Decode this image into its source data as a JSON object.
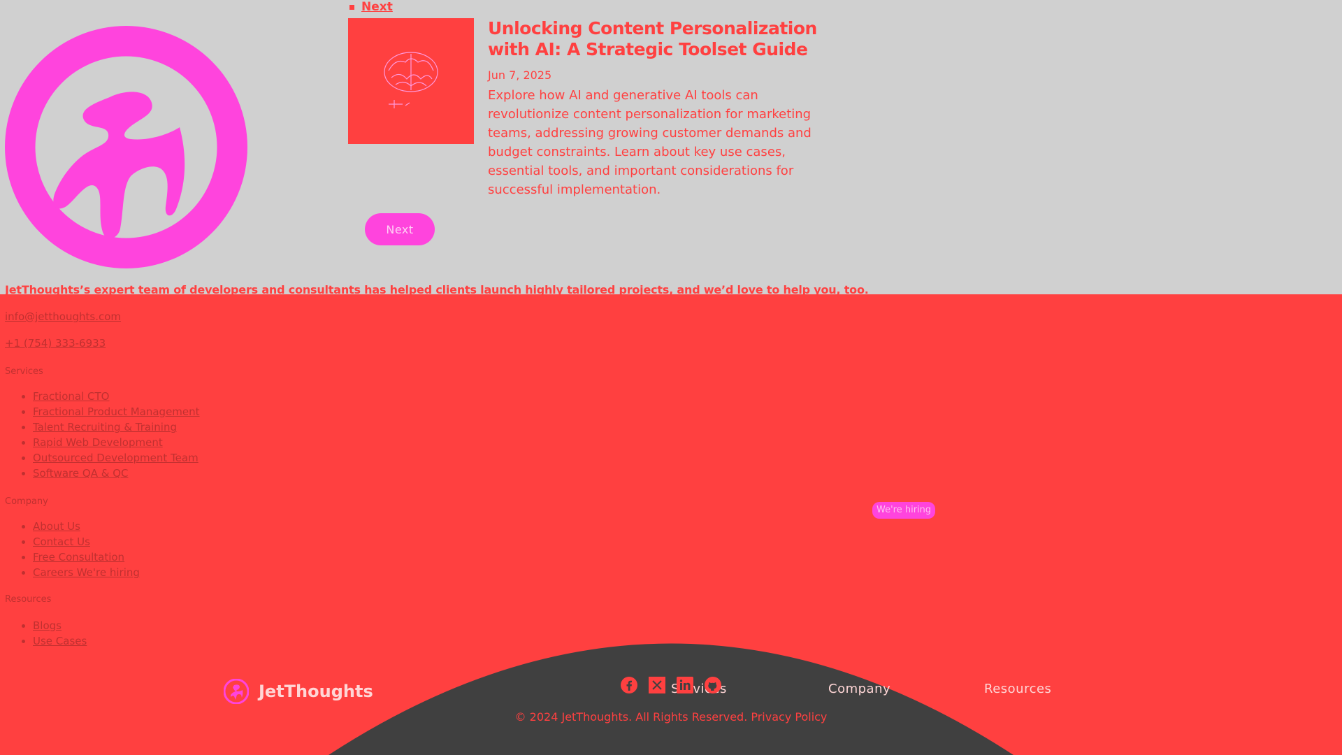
{
  "pager_top": {
    "next_link": "Next"
  },
  "article": {
    "title": "Unlocking Content Personalization with AI: A Strategic Toolset Guide",
    "date": "Jun 7, 2025",
    "description": "Explore how AI and generative AI tools can revolutionize content personalization for marketing teams, addressing growing customer demands and budget constraints. Learn about key use cases, essential tools, and important considerations for successful implementation."
  },
  "next_button": "Next",
  "footer": {
    "tagline": "JetThoughts’s expert team of developers and consultants has helped clients launch highly tailored projects, and we’d love to help you, too.",
    "email": "info@jetthoughts.com",
    "phone": "+1 (754) 333-6933",
    "brand_name": "JetThoughts",
    "columns": {
      "services": "Services",
      "company": "Company",
      "resources": "Resources"
    },
    "sections": {
      "services_heading": "Services",
      "services_items": [
        "Fractional CTO",
        "Fractional Product Management",
        "Talent Recruiting & Training",
        "Rapid Web Development",
        "Outsourced Development Team",
        "Software QA & QC"
      ],
      "company_heading": "Company",
      "company_items": [
        "About Us",
        "Contact Us",
        "Free Consultation",
        "Careers We're hiring"
      ],
      "resources_heading": "Resources",
      "resources_items": [
        "Blogs",
        "Use Cases"
      ]
    },
    "hiring_badge": "We're hiring",
    "social_icons": [
      "facebook-icon",
      "x-icon",
      "linkedin-icon",
      "github-icon"
    ],
    "copyright": "© 2024 JetThoughts. All Rights Reserved. Privacy Policy"
  },
  "colors": {
    "background": "#d0d0d0",
    "accent_red": "#ff4040",
    "accent_magenta": "#ff44dd",
    "dark_arc": "#404040"
  }
}
